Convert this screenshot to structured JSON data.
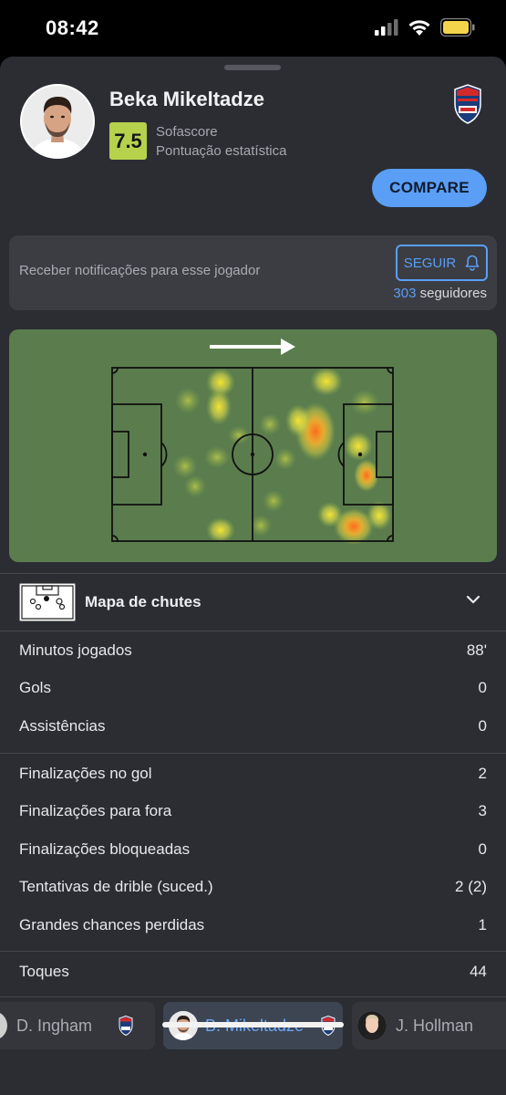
{
  "status": {
    "time": "08:42"
  },
  "player": {
    "name": "Beka Mikeltadze",
    "rating": "7.5",
    "rating_source": "Sofascore",
    "rating_subtitle": "Pontuação estatística",
    "team_logo": "newcastle-jets-logo"
  },
  "compare_label": "COMPARE",
  "notifications": {
    "text": "Receber notificações para esse jogador",
    "follow_label": "SEGUIR",
    "followers_count": "303",
    "followers_label": " seguidores"
  },
  "shotmap": {
    "label": "Mapa de chutes"
  },
  "stats_group_1": [
    {
      "label": "Minutos jogados",
      "value": "88'"
    },
    {
      "label": "Gols",
      "value": "0"
    },
    {
      "label": "Assistências",
      "value": "0"
    }
  ],
  "stats_group_2": [
    {
      "label": "Finalizações no gol",
      "value": "2"
    },
    {
      "label": "Finalizações para fora",
      "value": "3"
    },
    {
      "label": "Finalizações bloqueadas",
      "value": "0"
    },
    {
      "label": "Tentativas de drible (suced.)",
      "value": "2 (2)"
    },
    {
      "label": "Grandes chances perdidas",
      "value": "1"
    }
  ],
  "stats_group_3": [
    {
      "label": "Toques",
      "value": "44"
    }
  ],
  "switcher": [
    {
      "name": "D. Ingham"
    },
    {
      "name": "B. Mikeltadze"
    },
    {
      "name": "J. Hollman"
    }
  ],
  "colors": {
    "accent": "#5a9ef5",
    "rating": "#b6d24d",
    "pitch": "#5b7d4e",
    "sheet": "#2b2d33"
  }
}
